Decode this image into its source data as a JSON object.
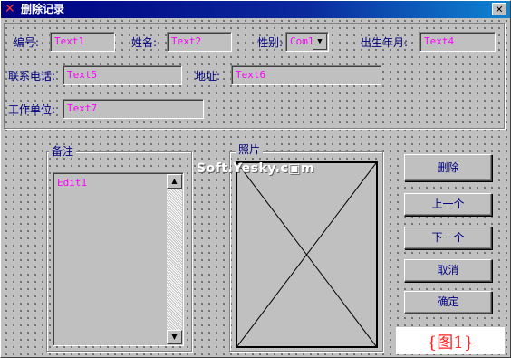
{
  "window": {
    "title": "删除记录",
    "close_glyph": "✕",
    "app_icon": "red-x-icon"
  },
  "fields": {
    "id": {
      "label": "编号:",
      "value": "Text1"
    },
    "name": {
      "label": "姓名:",
      "value": "Text2"
    },
    "gender": {
      "label": "性别:",
      "value": "Com1"
    },
    "birth": {
      "label": "出生年月:",
      "value": "Text4"
    },
    "phone": {
      "label": "联系电话:",
      "value": "Text5"
    },
    "address": {
      "label": "地址:",
      "value": "Text6"
    },
    "workplace": {
      "label": "工作单位:",
      "value": "Text7"
    }
  },
  "notes": {
    "title": "备注",
    "value": "Edit1"
  },
  "photo": {
    "title": "照片"
  },
  "buttons": {
    "delete": "删除",
    "prev": "上一个",
    "next": "下一个",
    "cancel": "取消",
    "ok": "确定"
  },
  "watermark": "Soft.Yesky.c▣m",
  "caption": "{图1}"
}
